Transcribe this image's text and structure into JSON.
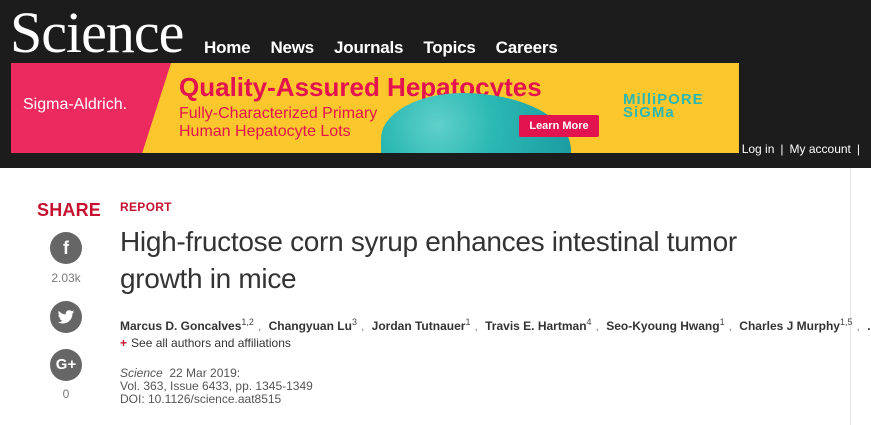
{
  "header": {
    "logo": "Science",
    "nav": [
      "Home",
      "News",
      "Journals",
      "Topics",
      "Careers"
    ],
    "account": [
      "Log in",
      "|",
      "My account",
      "|"
    ]
  },
  "ad": {
    "brand": "Sigma-Aldrich.",
    "title": "Quality-Assured Hepatocytes",
    "subtitle_line1": "Fully-Characterized Primary",
    "subtitle_line2": "Human Hepatocyte Lots",
    "cta": "Learn More",
    "partner_line1": "MilliPORE",
    "partner_line2": "SiGMa"
  },
  "share": {
    "title": "SHARE",
    "facebook_count": "2.03k",
    "google_count": "0"
  },
  "article": {
    "type": "REPORT",
    "title": "High-fructose corn syrup enhances intestinal tumor growth in mice",
    "authors": [
      {
        "name": "Marcus D. Goncalves",
        "aff": "1,2"
      },
      {
        "name": "Changyuan Lu",
        "aff": "3"
      },
      {
        "name": "Jordan Tutnauer",
        "aff": "1"
      },
      {
        "name": "Travis E. Hartman",
        "aff": "4"
      },
      {
        "name": "Seo-Kyoung Hwang",
        "aff": "1"
      },
      {
        "name": "Charles J Murphy",
        "aff": "1,5"
      }
    ],
    "authors_more": "...",
    "see_all": "See all authors and affiliations",
    "journal": "Science",
    "date": "22 Mar 2019:",
    "volume": "Vol. 363, Issue 6433, pp. 1345-1349",
    "doi": "DOI: 10.1126/science.aat8515"
  },
  "colors": {
    "header_bg": "#1c1c1c",
    "accent_red": "#c41230",
    "ad_yellow": "#fcc72c",
    "ad_pink": "#ec2a5f",
    "ad_teal": "#2bb8b3"
  }
}
